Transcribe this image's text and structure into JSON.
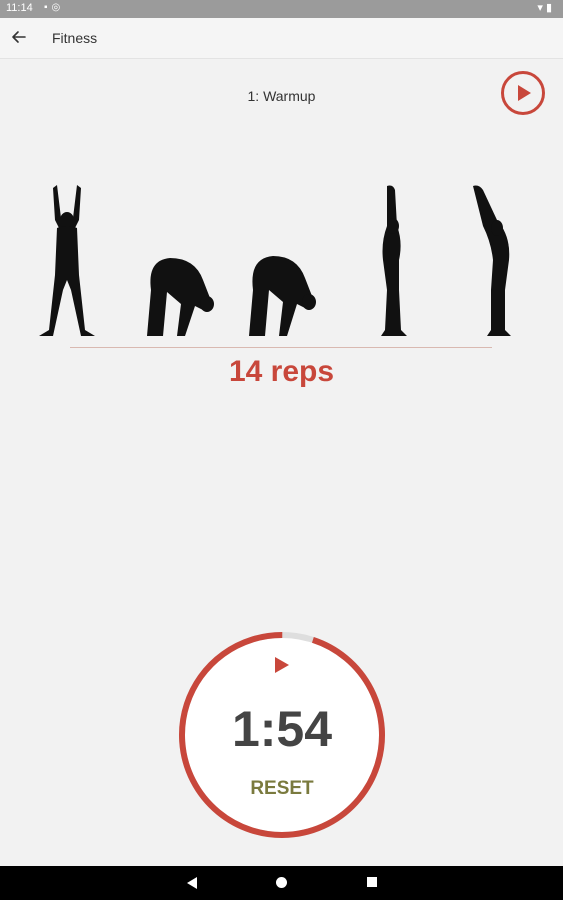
{
  "status_bar": {
    "time": "11:14",
    "left_icons": [
      "sd-card-icon",
      "notification-icon"
    ],
    "right_icons": [
      "wifi-icon",
      "battery-icon"
    ]
  },
  "app_bar": {
    "title": "Fitness",
    "back_icon": "arrow-left-icon"
  },
  "exercise": {
    "title": "1: Warmup",
    "reps": "14 reps",
    "figures": [
      "arms-up-figure",
      "forward-bend-figure",
      "forward-bend-figure",
      "arms-up-side-figure",
      "back-arch-figure"
    ]
  },
  "timer": {
    "time": "1:54",
    "reset_label": "RESET",
    "progress": 0.95
  },
  "colors": {
    "accent": "#c8473b",
    "reset": "#7a7a3e",
    "background": "#f2f2f2"
  },
  "nav_bar": {
    "buttons": [
      "back-triangle-icon",
      "home-circle-icon",
      "recents-square-icon"
    ]
  }
}
